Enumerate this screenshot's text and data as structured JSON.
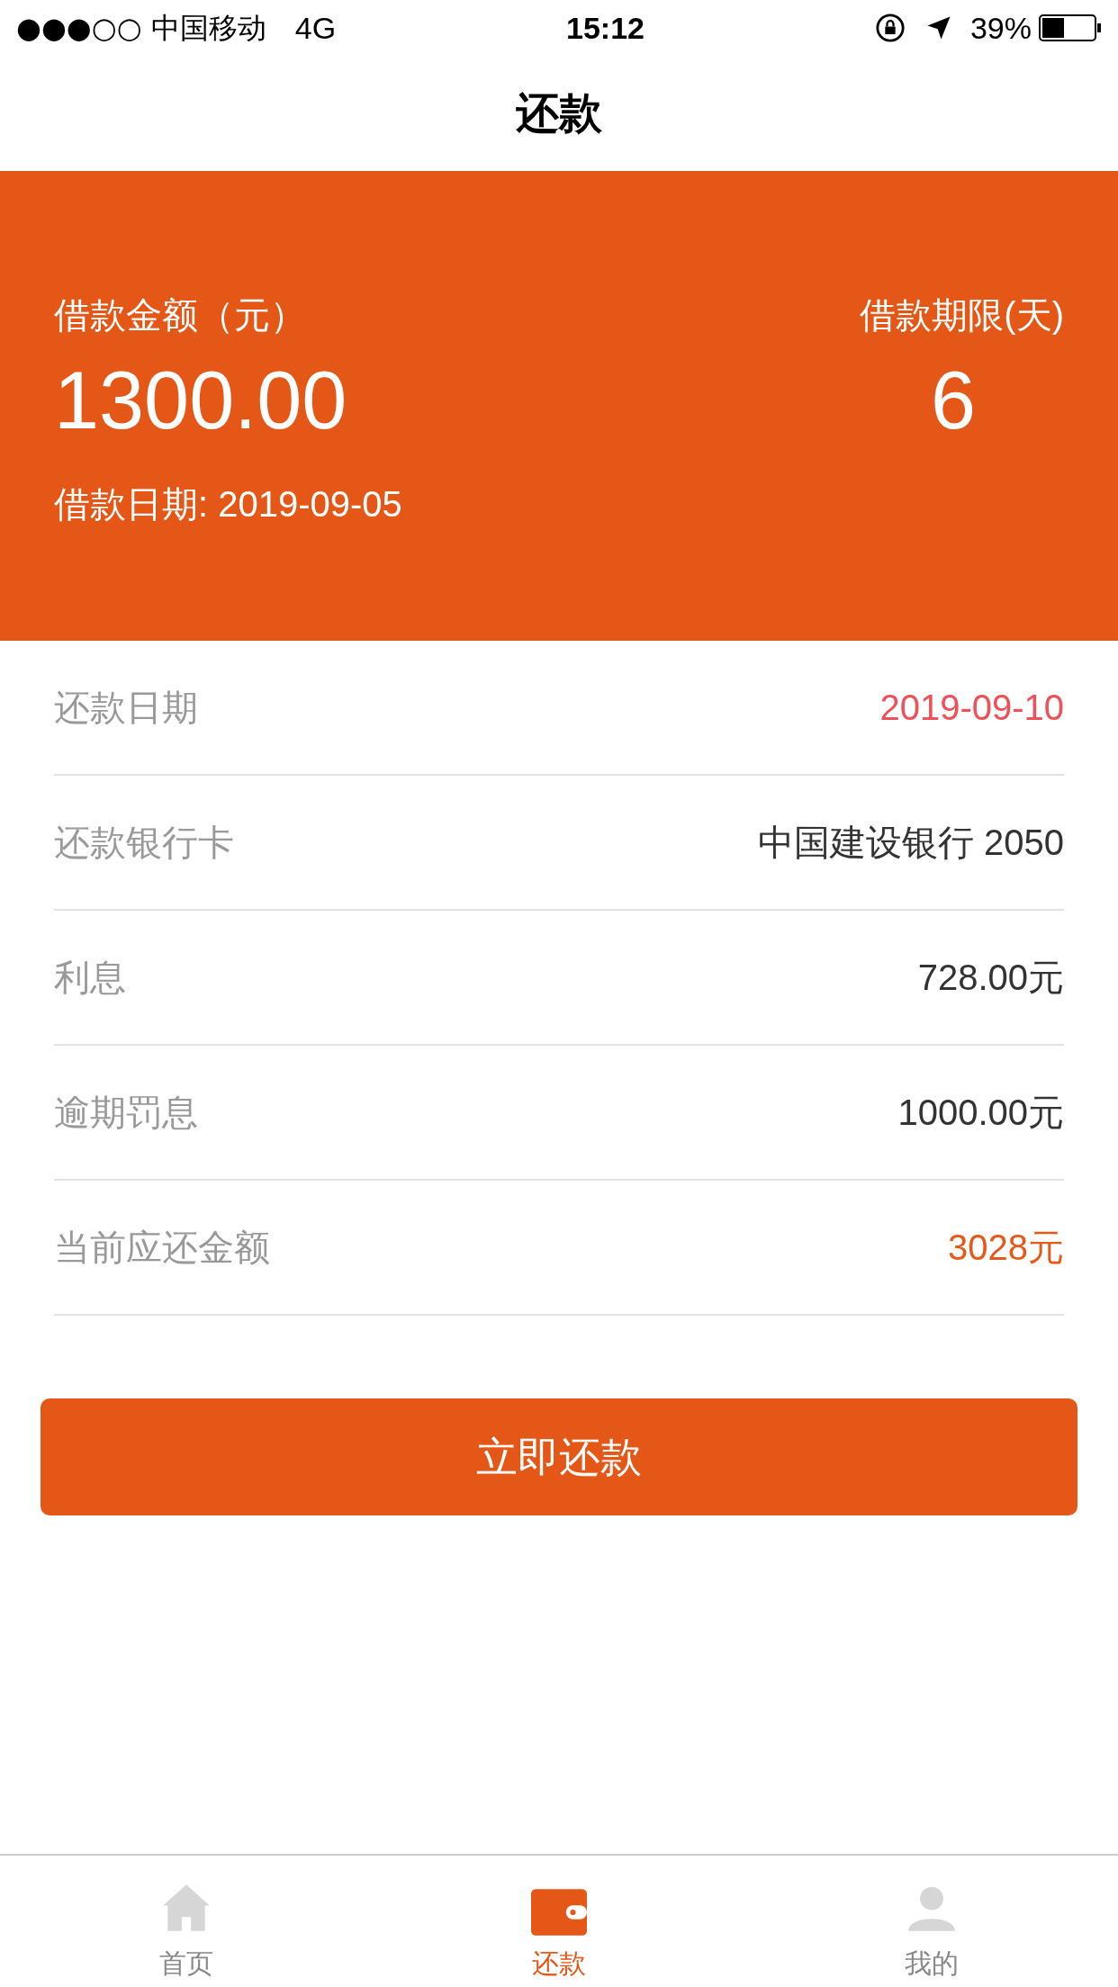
{
  "status_bar": {
    "carrier": "●●●○○ 中国移动",
    "network": "4G",
    "time": "15:12",
    "battery": "39%"
  },
  "nav": {
    "title": "还款"
  },
  "loan": {
    "amount_label": "借款金额（元）",
    "amount": "1300.00",
    "term_label": "借款期限(天)",
    "term": "6",
    "date": "借款日期: 2019-09-05"
  },
  "rows": [
    {
      "label": "还款日期",
      "value": "2019-09-10",
      "color": "#f0505a"
    },
    {
      "label": "还款银行卡",
      "value": "中国建设银行 2050",
      "color": "#333333"
    },
    {
      "label": "利息",
      "value": "728.00元",
      "color": "#333333"
    },
    {
      "label": "逾期罚息",
      "value": "1000.00元",
      "color": "#333333"
    },
    {
      "label": "当前应还金额",
      "value": "3028元",
      "color": "#e55a1a"
    }
  ],
  "pay_button": "立即还款",
  "tabs": [
    {
      "label": "首页",
      "kind": "home",
      "selected": false
    },
    {
      "label": "还款",
      "kind": "wallet",
      "selected": true
    },
    {
      "label": "我的",
      "kind": "user",
      "selected": false
    }
  ]
}
